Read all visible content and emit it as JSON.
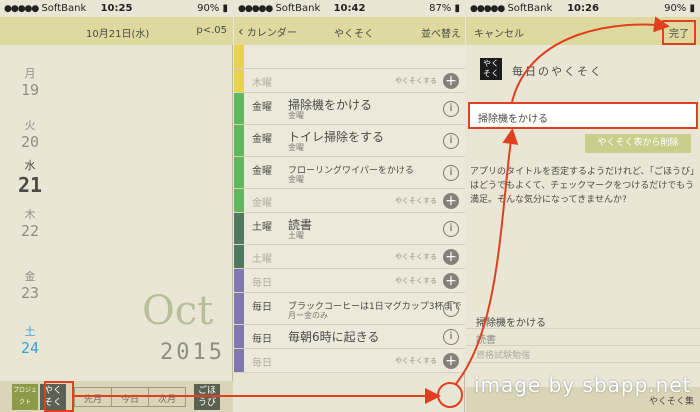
{
  "status": {
    "carrier": "SoftBank",
    "panel1_time": "10:25",
    "panel1_battery": "90%",
    "panel2_time": "10:42",
    "panel2_battery": "87%",
    "panel3_time": "10:26",
    "panel3_battery": "90%"
  },
  "calendar": {
    "header_date": "10月21日(水)",
    "header_right": "p<.05",
    "days": [
      {
        "w": "月",
        "n": "19"
      },
      {
        "w": "火",
        "n": "20"
      },
      {
        "w": "水",
        "n": "21"
      },
      {
        "w": "木",
        "n": "22"
      },
      {
        "w": "金",
        "n": "23"
      },
      {
        "w": "土",
        "n": "24"
      }
    ],
    "month": "Oct",
    "year": "2015",
    "toolbar": {
      "project": "プロジェクト",
      "yakusoku": "やくそく",
      "prev": "先月",
      "today": "今日",
      "next": "次月",
      "gohoubi": "ごほうび"
    }
  },
  "list": {
    "back_label": "カレンダー",
    "title": "やくそく",
    "sort_label": "並べ替え",
    "rows": [
      {
        "day": "",
        "task": "",
        "sub": "",
        "tag": "",
        "color": "#e8d34a",
        "type": "blank"
      },
      {
        "day": "木曜",
        "task": "",
        "sub": "",
        "tag": "やくそくする",
        "color": "#e8d34a",
        "type": "add"
      },
      {
        "day": "金曜",
        "task": "掃除機をかける",
        "sub": "金曜",
        "tag": "",
        "color": "#5fb85a",
        "type": "info"
      },
      {
        "day": "金曜",
        "task": "トイレ掃除をする",
        "sub": "金曜",
        "tag": "",
        "color": "#5fb85a",
        "type": "info"
      },
      {
        "day": "金曜",
        "task": "フローリングワイパーをかける",
        "sub": "金曜",
        "tag": "",
        "color": "#5fb85a",
        "type": "info_small"
      },
      {
        "day": "金曜",
        "task": "",
        "sub": "",
        "tag": "やくそくする",
        "color": "#5fb85a",
        "type": "add"
      },
      {
        "day": "土曜",
        "task": "読書",
        "sub": "土曜",
        "tag": "",
        "color": "#4f7a62",
        "type": "info"
      },
      {
        "day": "土曜",
        "task": "",
        "sub": "",
        "tag": "やくそくする",
        "color": "#4f7a62",
        "type": "add"
      },
      {
        "day": "毎日",
        "task": "",
        "sub": "",
        "tag": "やくそくする",
        "color": "#7f79b0",
        "type": "add"
      },
      {
        "day": "毎日",
        "task": "ブラックコーヒーは1日マグカップ3杯まで",
        "sub": "月ー金のみ",
        "tag": "",
        "color": "#7f79b0",
        "type": "info_small"
      },
      {
        "day": "毎日",
        "task": "毎朝6時に起きる",
        "sub": "",
        "tag": "",
        "color": "#7f79b0",
        "type": "info"
      },
      {
        "day": "毎日",
        "task": "",
        "sub": "",
        "tag": "やくそくする",
        "color": "#7f79b0",
        "type": "add"
      }
    ],
    "top_sub_label": "月ー金のみ"
  },
  "edit": {
    "cancel": "キャンセル",
    "done": "完了",
    "app_icon_text": "やくそく",
    "app_name": "毎日のやくそく",
    "title_value": "掃除機をかける",
    "delete_button": "やくそく表から削除",
    "description": "アプリのタイトルを否定するようだけれど、「ごほうび」はどうでもよくて、チェックマークをつけるだけでもう満足。そんな気分になってきませんか?",
    "items": [
      "掃除機をかける",
      "読書",
      "資格試験勉強"
    ],
    "toolbar_right": "やくそく集"
  },
  "watermark": "image by sbapp.net",
  "colors": {
    "accent": "#e0401f",
    "nav": "#deda9f",
    "bg": "#e9e6d6"
  }
}
